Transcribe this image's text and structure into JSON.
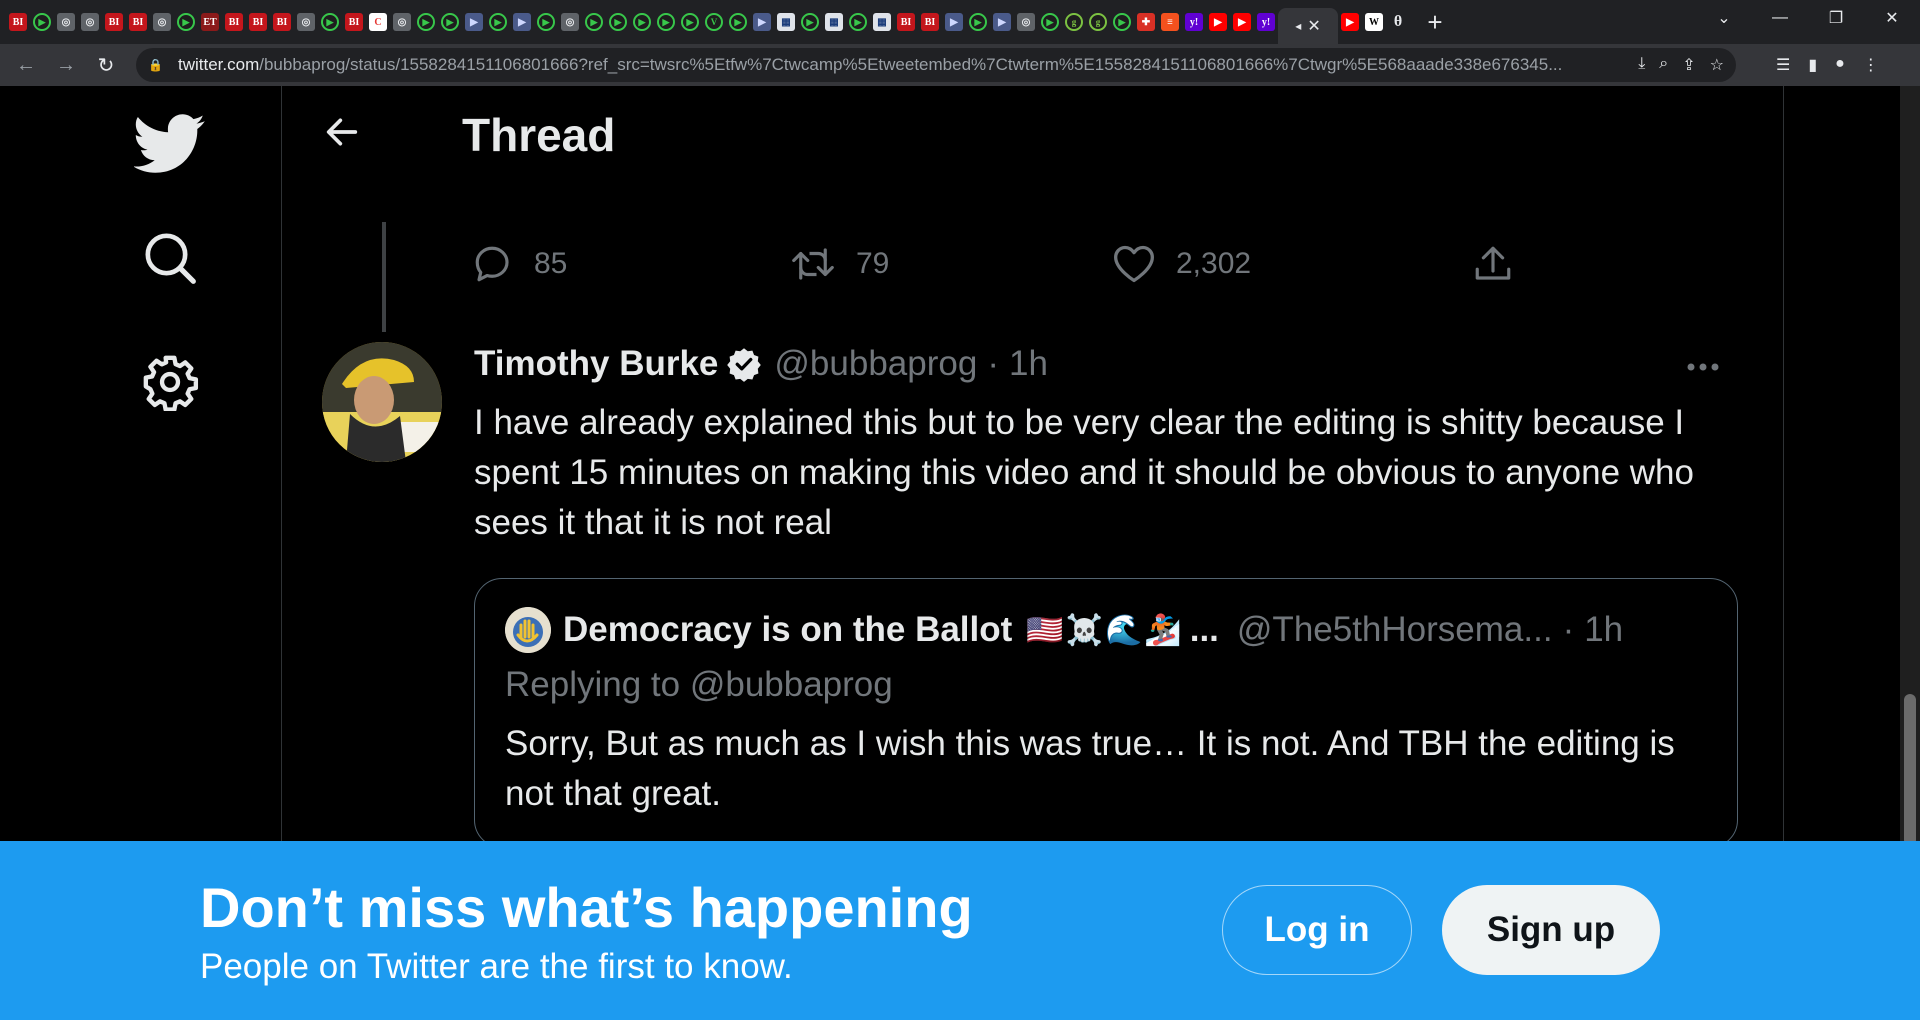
{
  "browser": {
    "tabs": [
      {
        "icon": "bi",
        "text": "BI"
      },
      {
        "icon": "play"
      },
      {
        "icon": "globe"
      },
      {
        "icon": "globe"
      },
      {
        "icon": "bi",
        "text": "BI"
      },
      {
        "icon": "bi",
        "text": "BI"
      },
      {
        "icon": "globe"
      },
      {
        "icon": "play"
      },
      {
        "icon": "et",
        "text": "ET"
      },
      {
        "icon": "bi",
        "text": "BI"
      },
      {
        "icon": "bi",
        "text": "BI"
      },
      {
        "icon": "bi",
        "text": "BI"
      },
      {
        "icon": "globe"
      },
      {
        "icon": "play"
      },
      {
        "icon": "bi",
        "text": "BI"
      },
      {
        "icon": "c"
      },
      {
        "icon": "globe"
      },
      {
        "icon": "play"
      },
      {
        "icon": "play"
      },
      {
        "icon": "flag"
      },
      {
        "icon": "play"
      },
      {
        "icon": "flag"
      },
      {
        "icon": "play"
      },
      {
        "icon": "globe"
      },
      {
        "icon": "play"
      },
      {
        "icon": "play"
      },
      {
        "icon": "play"
      },
      {
        "icon": "play"
      },
      {
        "icon": "play"
      },
      {
        "icon": "v",
        "text": "V"
      },
      {
        "icon": "play"
      },
      {
        "icon": "flag"
      },
      {
        "icon": "box"
      },
      {
        "icon": "play"
      },
      {
        "icon": "box"
      },
      {
        "icon": "play"
      },
      {
        "icon": "box"
      },
      {
        "icon": "bi",
        "text": "BI"
      },
      {
        "icon": "bi",
        "text": "BI"
      },
      {
        "icon": "flag"
      },
      {
        "icon": "play"
      },
      {
        "icon": "flag"
      },
      {
        "icon": "globe"
      },
      {
        "icon": "play"
      },
      {
        "icon": "g",
        "text": "g"
      },
      {
        "icon": "g",
        "text": "g"
      },
      {
        "icon": "play"
      },
      {
        "icon": "red"
      },
      {
        "icon": "orange"
      },
      {
        "icon": "yahoo",
        "text": "y!"
      },
      {
        "icon": "yt"
      },
      {
        "icon": "yt"
      },
      {
        "icon": "yahoo",
        "text": "y!"
      }
    ],
    "active_tab_close": "✕",
    "new_tab": "+",
    "url_domain": "twitter.com",
    "url_rest": "/bubbaprog/status/1558284151106801666?ref_src=twsrc%5Etfw%7Ctwcamp%5Etweetembed%7Ctwterm%5E1558284151106801666%7Ctwgr%5E568aaade338e676345...",
    "window": {
      "minimize": "—",
      "maximize": "❐",
      "close": "✕"
    }
  },
  "header": {
    "title": "Thread"
  },
  "actions": {
    "replies": "85",
    "retweets": "79",
    "likes": "2,302"
  },
  "tweet": {
    "author_name": "Timothy Burke",
    "handle": "@bubbaprog",
    "time": "1h",
    "text": "I have already explained this but to be very clear the editing is shitty because I spent 15 minutes on making this video and it should be obvious to anyone who sees it that it is not real"
  },
  "quote": {
    "author_name": "Democracy is on the Ballot",
    "emojis": "🇺🇸☠️🌊🏂",
    "ellipsis": "...",
    "handle": "@The5thHorsema...",
    "time": "1h",
    "replying": "Replying to @bubbaprog",
    "text": "Sorry, But as much as I wish this was true… It is not. And TBH the editing is not that great."
  },
  "banner": {
    "title": "Don’t miss what’s happening",
    "subtitle": "People on Twitter are the first to know.",
    "login": "Log in",
    "signup": "Sign up"
  },
  "colors": {
    "twitter_blue": "#1d9bf0",
    "background": "#000000",
    "muted": "#71767b"
  }
}
